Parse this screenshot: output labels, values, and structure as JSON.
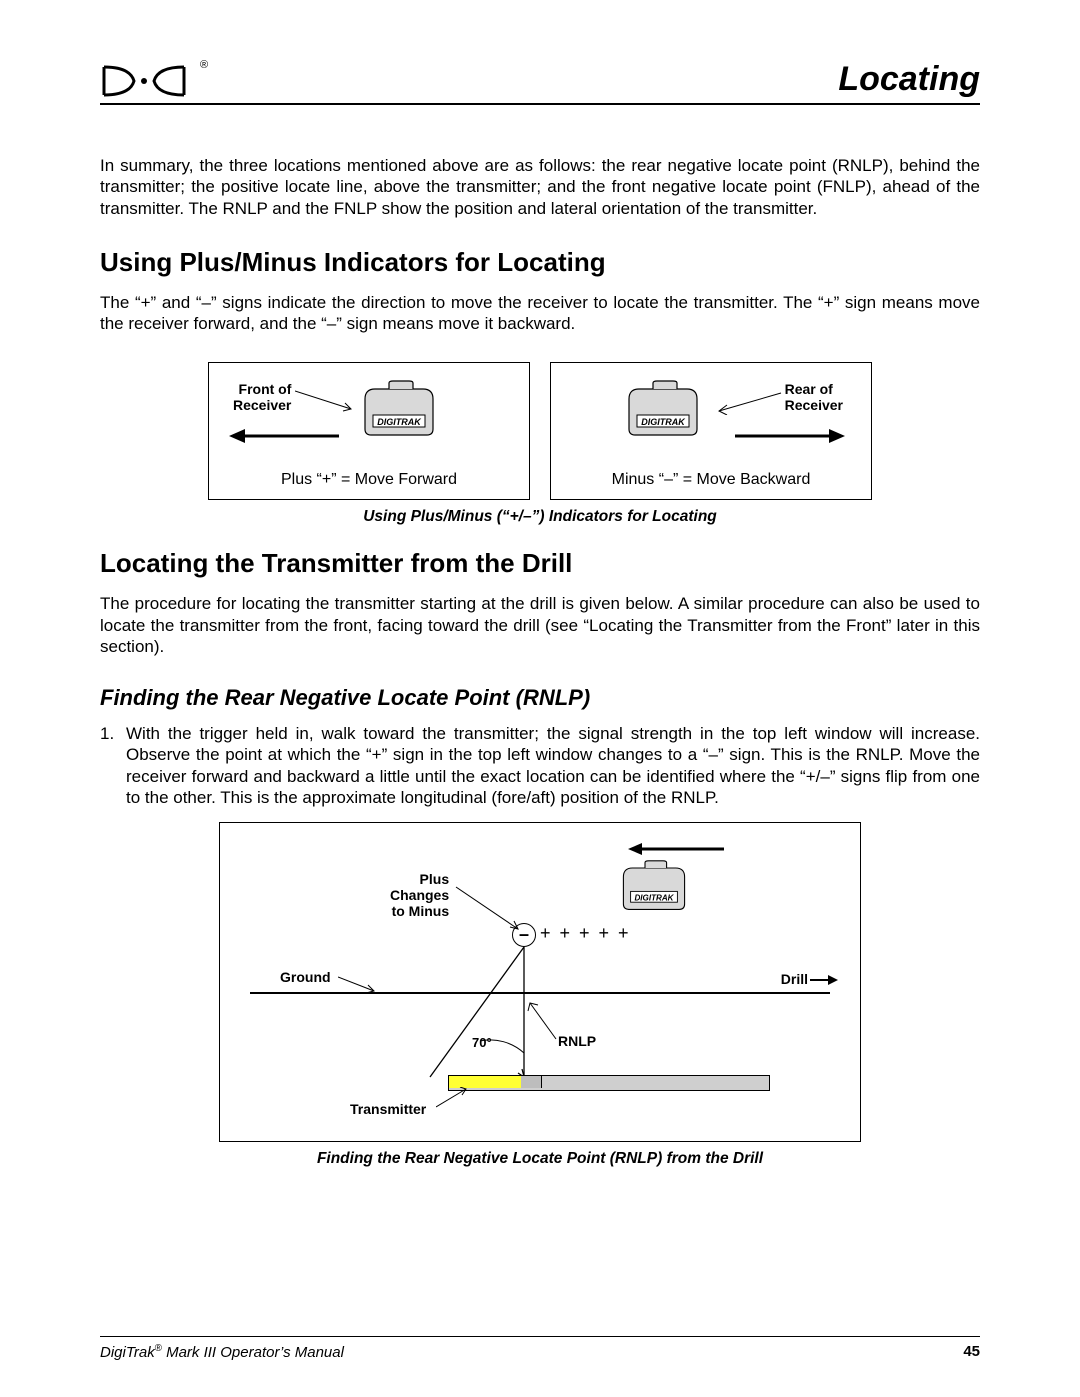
{
  "header": {
    "section": "Locating",
    "logo_reg": "®"
  },
  "p_summary": "In summary, the three locations mentioned above are as follows:  the rear negative locate point (RNLP), behind the transmitter; the positive locate line, above the transmitter; and the front negative locate point (FNLP), ahead of the transmitter.  The RNLP and the FNLP show the position and lateral orientation of the transmitter.",
  "h2_plusminus": "Using Plus/Minus Indicators for Locating",
  "p_plusminus": "The “+” and “–” signs indicate the direction to move the receiver to locate the transmitter.  The “+” sign means move the receiver forward, and the “–” sign means move it backward.",
  "panel_left": {
    "label": "Front of\nReceiver",
    "caption": "Plus “+”  =  Move Forward",
    "device": "DIGITRAK"
  },
  "panel_right": {
    "label": "Rear of\nReceiver",
    "caption": "Minus “–”  =  Move Backward",
    "device": "DIGITRAK"
  },
  "fig1_caption": "Using Plus/Minus (“+/–”) Indicators for Locating",
  "h2_locating": "Locating the Transmitter from the Drill",
  "p_locating": "The procedure for locating the transmitter starting at the drill is given below.  A similar procedure can also be used to locate the transmitter from the front, facing toward the drill (see “Locating the Transmitter from the Front” later in this section).",
  "h3_rnlp": "Finding the Rear Negative Locate Point (RNLP)",
  "step1_num": "1.",
  "step1": "With the trigger held in, walk toward the transmitter; the signal strength in the top left window will increase.  Observe the point at which the “+” sign in the top left window changes to a “–” sign.  This is the RNLP.  Move the receiver forward and backward a little until the exact location can be identified where the “+/–” signs flip from one to the other.  This is the approximate longitudinal (fore/aft) position of the RNLP.",
  "fig2": {
    "plus_label": "Plus\nChanges\nto Minus",
    "minus": "–",
    "plus_trail": "+ + + + +",
    "ground": "Ground",
    "drill": "Drill",
    "angle": "70°",
    "rnlp": "RNLP",
    "transmitter": "Transmitter",
    "device": "DIGITRAK"
  },
  "fig2_caption": "Finding the Rear Negative Locate Point (RNLP) from the Drill",
  "footer": {
    "left_prefix": "DigiTrak",
    "left_suffix": " Mark III Operator’s Manual",
    "page": "45"
  }
}
